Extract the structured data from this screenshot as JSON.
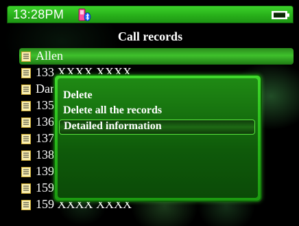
{
  "status_bar": {
    "time": "13:28PM",
    "bluetooth_icon": "phone-bluetooth-icon",
    "battery_icon": "battery-icon"
  },
  "screen_title": "Call records",
  "call_records": [
    {
      "label": "Allen",
      "selected": true
    },
    {
      "label": "133 XXXX XXXX",
      "selected": false
    },
    {
      "label": "Daniel",
      "selected": false
    },
    {
      "label": "135 XXXX XXXX",
      "selected": false
    },
    {
      "label": "136 XXXX XXXX",
      "selected": false
    },
    {
      "label": "137 XXXX XXXX",
      "selected": false
    },
    {
      "label": "138 XXXX XXXX",
      "selected": false
    },
    {
      "label": "139 XXXX XXXX",
      "selected": false
    },
    {
      "label": "159 XXXX XXXX",
      "selected": false
    },
    {
      "label": "159 XXXX XXXX",
      "selected": false
    }
  ],
  "context_menu": {
    "options": [
      {
        "label": "Delete",
        "highlighted": false
      },
      {
        "label": "Delete all the records",
        "highlighted": false
      },
      {
        "label": "Detailed information",
        "highlighted": true
      }
    ]
  },
  "colors": {
    "accent_green": "#2cbf1c",
    "background": "#000000",
    "text": "#ffffff"
  }
}
